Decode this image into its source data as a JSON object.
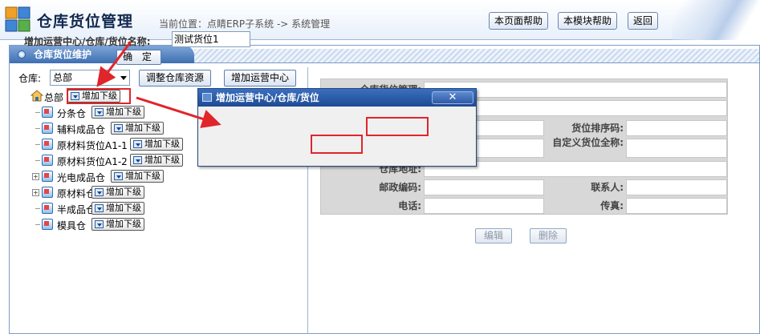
{
  "header": {
    "title": "仓库货位管理",
    "breadcrumb": "当前位置：点睛ERP子系统 -> 系统管理",
    "buttons": {
      "page_help": "本页面帮助",
      "module_help": "本模块帮助",
      "back": "返回"
    }
  },
  "panel": {
    "title": "仓库货位维护"
  },
  "warehouse": {
    "label": "仓库:",
    "selected": "总部",
    "adjust_button": "调整仓库资源",
    "add_center_button": "增加运营中心"
  },
  "tree": {
    "add_child_label": "增加下级",
    "root": "总部",
    "items": [
      "分条仓",
      "辅料成品仓",
      "原材料货位A1-1",
      "原材料货位A1-2",
      "光电成品仓",
      "原材料仓",
      "半成品仓",
      "模具仓"
    ]
  },
  "form": {
    "fields": {
      "manager": "仓库货位管理:",
      "sort_code": "货位排序码:",
      "custom_full_name": "自定义货位全称:",
      "address": "仓库地址:",
      "postal_code": "邮政编码:",
      "contact": "联系人:",
      "phone": "电话:",
      "fax": "传真:"
    },
    "edit_button": "编辑",
    "delete_button": "删除"
  },
  "modal": {
    "title": "增加运营中心/仓库/货位",
    "close_symbol": "✕",
    "field_label": "增加运营中心/仓库/货位名称:",
    "field_value": "测试货位1",
    "ok_button": "确 定"
  },
  "colors": {
    "highlight": "#e0252b",
    "title_bar": "#1e4a93"
  }
}
